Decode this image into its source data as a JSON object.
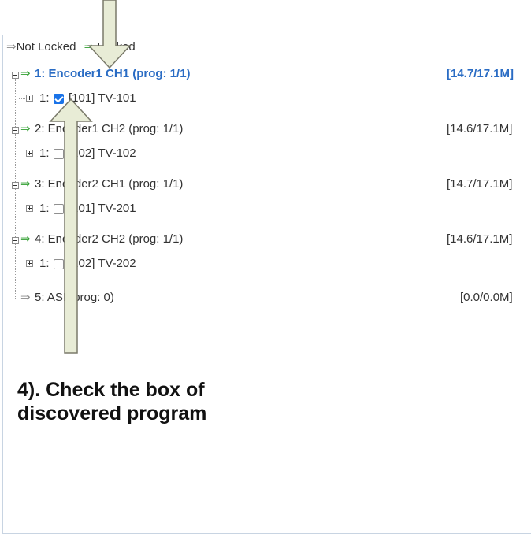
{
  "legend": {
    "not_locked": "Not Locked",
    "locked": "Locked"
  },
  "encoders": [
    {
      "label": "1: Encoder1 CH1 (prog: 1/1)",
      "rate": "[14.7/17.1M]",
      "selected": true,
      "program": {
        "num": "1:",
        "checked": true,
        "label": "[101] TV-101"
      }
    },
    {
      "label": "2: Encoder1 CH2 (prog: 1/1)",
      "rate": "[14.6/17.1M]",
      "selected": false,
      "program": {
        "num": "1:",
        "checked": false,
        "label": "[102] TV-102"
      }
    },
    {
      "label": "3: Encoder2 CH1 (prog: 1/1)",
      "rate": "[14.7/17.1M]",
      "selected": false,
      "program": {
        "num": "1:",
        "checked": false,
        "label": "[201] TV-201"
      }
    },
    {
      "label": "4: Encoder2 CH2 (prog: 1/1)",
      "rate": "[14.6/17.1M]",
      "selected": false,
      "program": {
        "num": "1:",
        "checked": false,
        "label": "[202] TV-202"
      }
    }
  ],
  "asi": {
    "label": "5: ASI (prog: 0)",
    "rate": "[0.0/0.0M]"
  },
  "annotation": {
    "line1": "4). Check the box of",
    "line2": "discovered program"
  },
  "colors": {
    "locked_arrow": "#2f9e2f",
    "not_locked_arrow": "#8a8a8a",
    "selected_text": "#2a6cc4",
    "checkbox_checked": "#1a73e8",
    "callout_arrow_fill": "#e8ecd6",
    "callout_arrow_stroke": "#7a7a6a"
  },
  "icons": {
    "not_locked": "arrow-right-icon",
    "locked": "arrow-right-icon",
    "expand": "plus-box-icon",
    "collapse": "minus-box-icon",
    "callout": "callout-arrow-icon"
  }
}
